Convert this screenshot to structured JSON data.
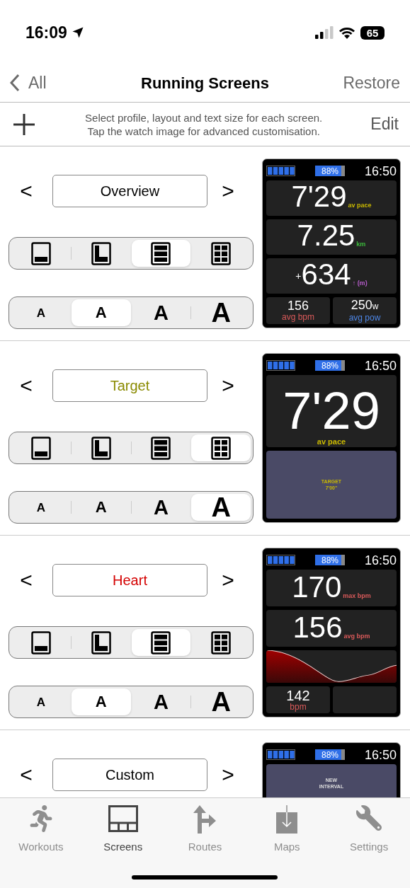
{
  "status_bar": {
    "time": "16:09",
    "battery": "65"
  },
  "nav": {
    "back": "All",
    "title": "Running Screens",
    "action": "Restore"
  },
  "info": {
    "lines": [
      "Select profile, layout and text size for each screen.",
      "Tap the watch image for advanced customisation."
    ],
    "action": "Edit"
  },
  "screens": [
    {
      "name": "Overview",
      "color": "#000000",
      "prev": "<",
      "next": ">",
      "layouts": [
        {
          "kind": "bottom",
          "selected": false
        },
        {
          "kind": "corner",
          "selected": false
        },
        {
          "kind": "rows",
          "selected": true
        },
        {
          "kind": "grid",
          "selected": false
        }
      ],
      "text_sizes": [
        {
          "label": "A",
          "kind": "small",
          "selected": false
        },
        {
          "label": "A",
          "kind": "medium",
          "selected": true
        },
        {
          "label": "A",
          "kind": "large",
          "selected": false
        },
        {
          "label": "A",
          "kind": "xlarge",
          "selected": false
        }
      ],
      "watch": {
        "charge": "88%",
        "level": 0.88,
        "time": "16:50",
        "fields": [
          {
            "kind": "metric",
            "value": "7'29",
            "unit": "av pace",
            "color": "#c9b800"
          },
          {
            "kind": "metric",
            "value": "7.25",
            "unit": "km",
            "color": "#3dbb3d"
          },
          {
            "kind": "metric",
            "prefix": "+",
            "value": "634",
            "unit": "↑ (m)",
            "color": "#b45cc8"
          },
          {
            "kind": "pair",
            "items": [
              {
                "kind": "metric",
                "value": "156",
                "unit": "avg bpm",
                "color": "#d95a5a"
              },
              {
                "kind": "metric",
                "value": "250",
                "suffix": "w",
                "unit": "avg pow",
                "color": "#4d86e6"
              }
            ]
          }
        ]
      }
    },
    {
      "name": "Target",
      "color": "#8a8a00",
      "prev": "<",
      "next": ">",
      "layouts": [
        {
          "kind": "bottom",
          "selected": false
        },
        {
          "kind": "corner",
          "selected": false
        },
        {
          "kind": "rows",
          "selected": false
        },
        {
          "kind": "grid",
          "selected": true
        }
      ],
      "text_sizes": [
        {
          "label": "A",
          "kind": "small",
          "selected": false
        },
        {
          "label": "A",
          "kind": "medium",
          "selected": false
        },
        {
          "label": "A",
          "kind": "large",
          "selected": false
        },
        {
          "label": "A",
          "kind": "xlarge",
          "selected": true
        }
      ],
      "watch": {
        "charge": "88%",
        "level": 0.88,
        "time": "16:50",
        "fields": [
          {
            "kind": "big_metric",
            "value": "7'29",
            "unit": "av pace",
            "color": "#c9b800"
          },
          {
            "kind": "panel",
            "lines": [
              "TARGET",
              "7'00\""
            ],
            "color": "#c9b800"
          }
        ]
      }
    },
    {
      "name": "Heart",
      "color": "#d40000",
      "prev": "<",
      "next": ">",
      "layouts": [
        {
          "kind": "bottom",
          "selected": false
        },
        {
          "kind": "corner",
          "selected": false
        },
        {
          "kind": "rows",
          "selected": true
        },
        {
          "kind": "grid",
          "selected": false
        }
      ],
      "text_sizes": [
        {
          "label": "A",
          "kind": "small",
          "selected": false
        },
        {
          "label": "A",
          "kind": "medium",
          "selected": true
        },
        {
          "label": "A",
          "kind": "large",
          "selected": false
        },
        {
          "label": "A",
          "kind": "xlarge",
          "selected": false
        }
      ],
      "watch": {
        "charge": "88%",
        "level": 0.88,
        "time": "16:50",
        "fields": [
          {
            "kind": "metric",
            "value": "170",
            "unit": "max bpm",
            "color": "#d95a5a"
          },
          {
            "kind": "metric",
            "value": "156",
            "unit": "avg bpm",
            "color": "#d95a5a"
          },
          {
            "kind": "graph"
          },
          {
            "kind": "pair",
            "items": [
              {
                "kind": "stacked",
                "value": "142",
                "unit": "bpm",
                "color": "#d95a5a"
              },
              {
                "kind": "empty"
              }
            ]
          }
        ]
      }
    },
    {
      "name": "Custom",
      "color": "#000000",
      "prev": "<",
      "next": ">",
      "watch": {
        "charge": "88%",
        "level": 0.88,
        "time": "16:50",
        "fields": [
          {
            "kind": "interval_panel",
            "lines": [
              "NEW",
              "INTERVAL"
            ],
            "color": "#dddddd"
          }
        ]
      }
    }
  ],
  "tab_bar": [
    {
      "label": "Workouts",
      "kind": "runner",
      "selected": false
    },
    {
      "label": "Screens",
      "kind": "screens",
      "selected": true
    },
    {
      "label": "Routes",
      "kind": "routes",
      "selected": false
    },
    {
      "label": "Maps",
      "kind": "maps",
      "selected": false
    },
    {
      "label": "Settings",
      "kind": "wrench",
      "selected": false
    }
  ]
}
